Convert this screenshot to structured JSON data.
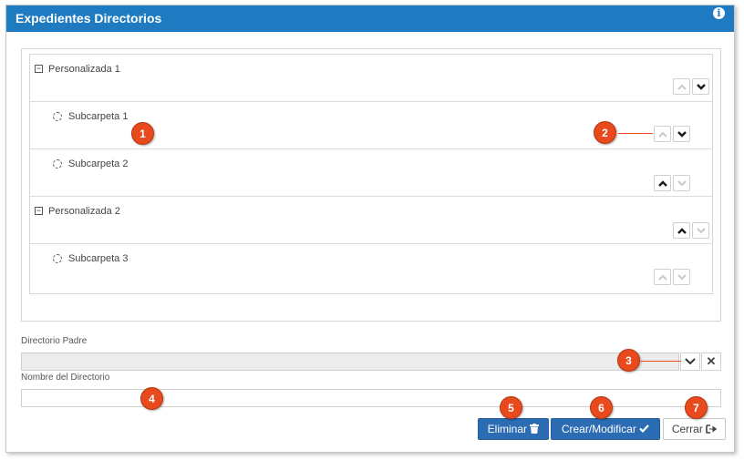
{
  "window": {
    "title": "Expedientes Directorios",
    "info_icon": "info-icon"
  },
  "tree": {
    "nodes": [
      {
        "label": "Personalizada 1",
        "type": "folder",
        "expander": "⊟",
        "up_enabled": false,
        "down_enabled": true
      },
      {
        "label": "Subcarpeta 1",
        "type": "subfolder",
        "up_enabled": false,
        "down_enabled": true
      },
      {
        "label": "Subcarpeta 2",
        "type": "subfolder",
        "up_enabled": true,
        "down_enabled": false
      },
      {
        "label": "Personalizada 2",
        "type": "folder",
        "expander": "⊟",
        "up_enabled": true,
        "down_enabled": false
      },
      {
        "label": "Subcarpeta 3",
        "type": "subfolder",
        "up_enabled": false,
        "down_enabled": false
      }
    ]
  },
  "form": {
    "parent_label": "Directorio Padre",
    "parent_value": "",
    "name_label": "Nombre del Directorio",
    "name_value": ""
  },
  "buttons": {
    "delete_label": "Eliminar",
    "save_label": "Crear/Modificar",
    "close_label": "Cerrar"
  },
  "callouts": [
    "1",
    "2",
    "3",
    "4",
    "5",
    "6",
    "7"
  ],
  "colors": {
    "header": "#1e7bc2",
    "primary_button": "#2b6cb3",
    "callout": "#e8491d"
  }
}
